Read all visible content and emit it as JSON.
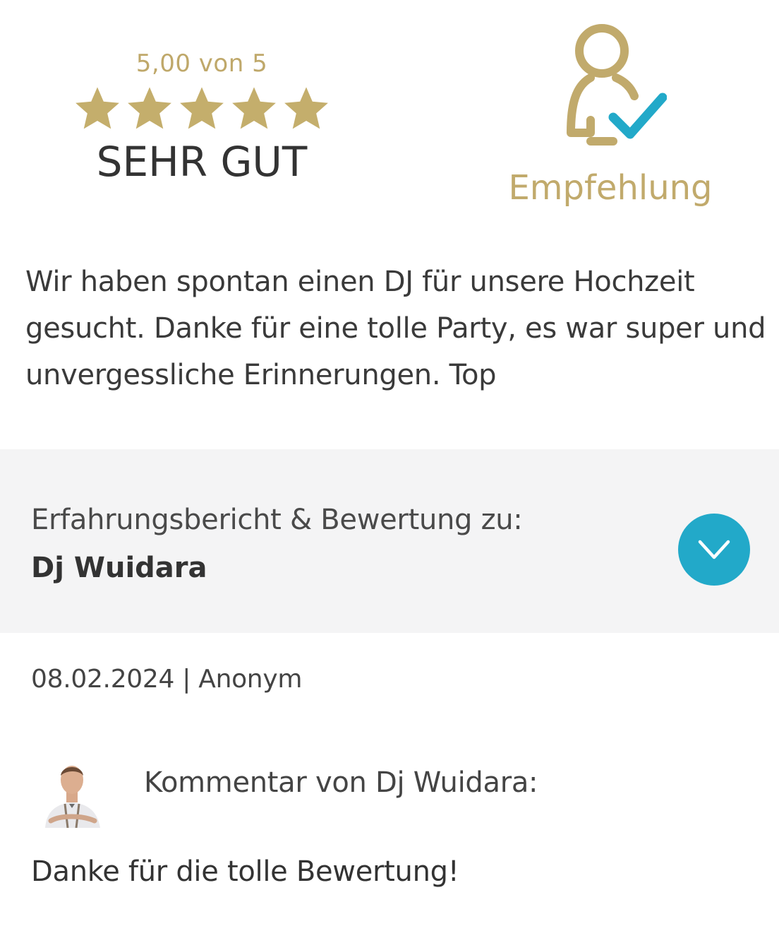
{
  "rating": {
    "score_text": "5,00 von 5",
    "stars_filled": 5,
    "stars_total": 5,
    "label": "SEHR GUT",
    "star_color": "#c4ae6c"
  },
  "recommendation": {
    "icon": "user-check-icon",
    "label": "Empfehlung",
    "gold_color": "#c1aa6c",
    "check_color": "#22a9c9"
  },
  "review": {
    "text": "Wir haben spontan einen DJ für unsere Hochzeit gesucht. Danke für eine tolle Party, es war super und unvergessliche Erinnerungen. Top",
    "date": "08.02.2024",
    "separator": "|",
    "author": "Anonym",
    "meta": "08.02.2024 | Anonym"
  },
  "about": {
    "heading": "Erfahrungsbericht & Bewertung zu:",
    "name": "Dj Wuidara",
    "expand_icon": "chevron-down-icon",
    "accent_color": "#22a9c9"
  },
  "comment": {
    "heading": "Kommentar von Dj Wuidara:",
    "text": "Danke für die tolle Bewertung!"
  }
}
